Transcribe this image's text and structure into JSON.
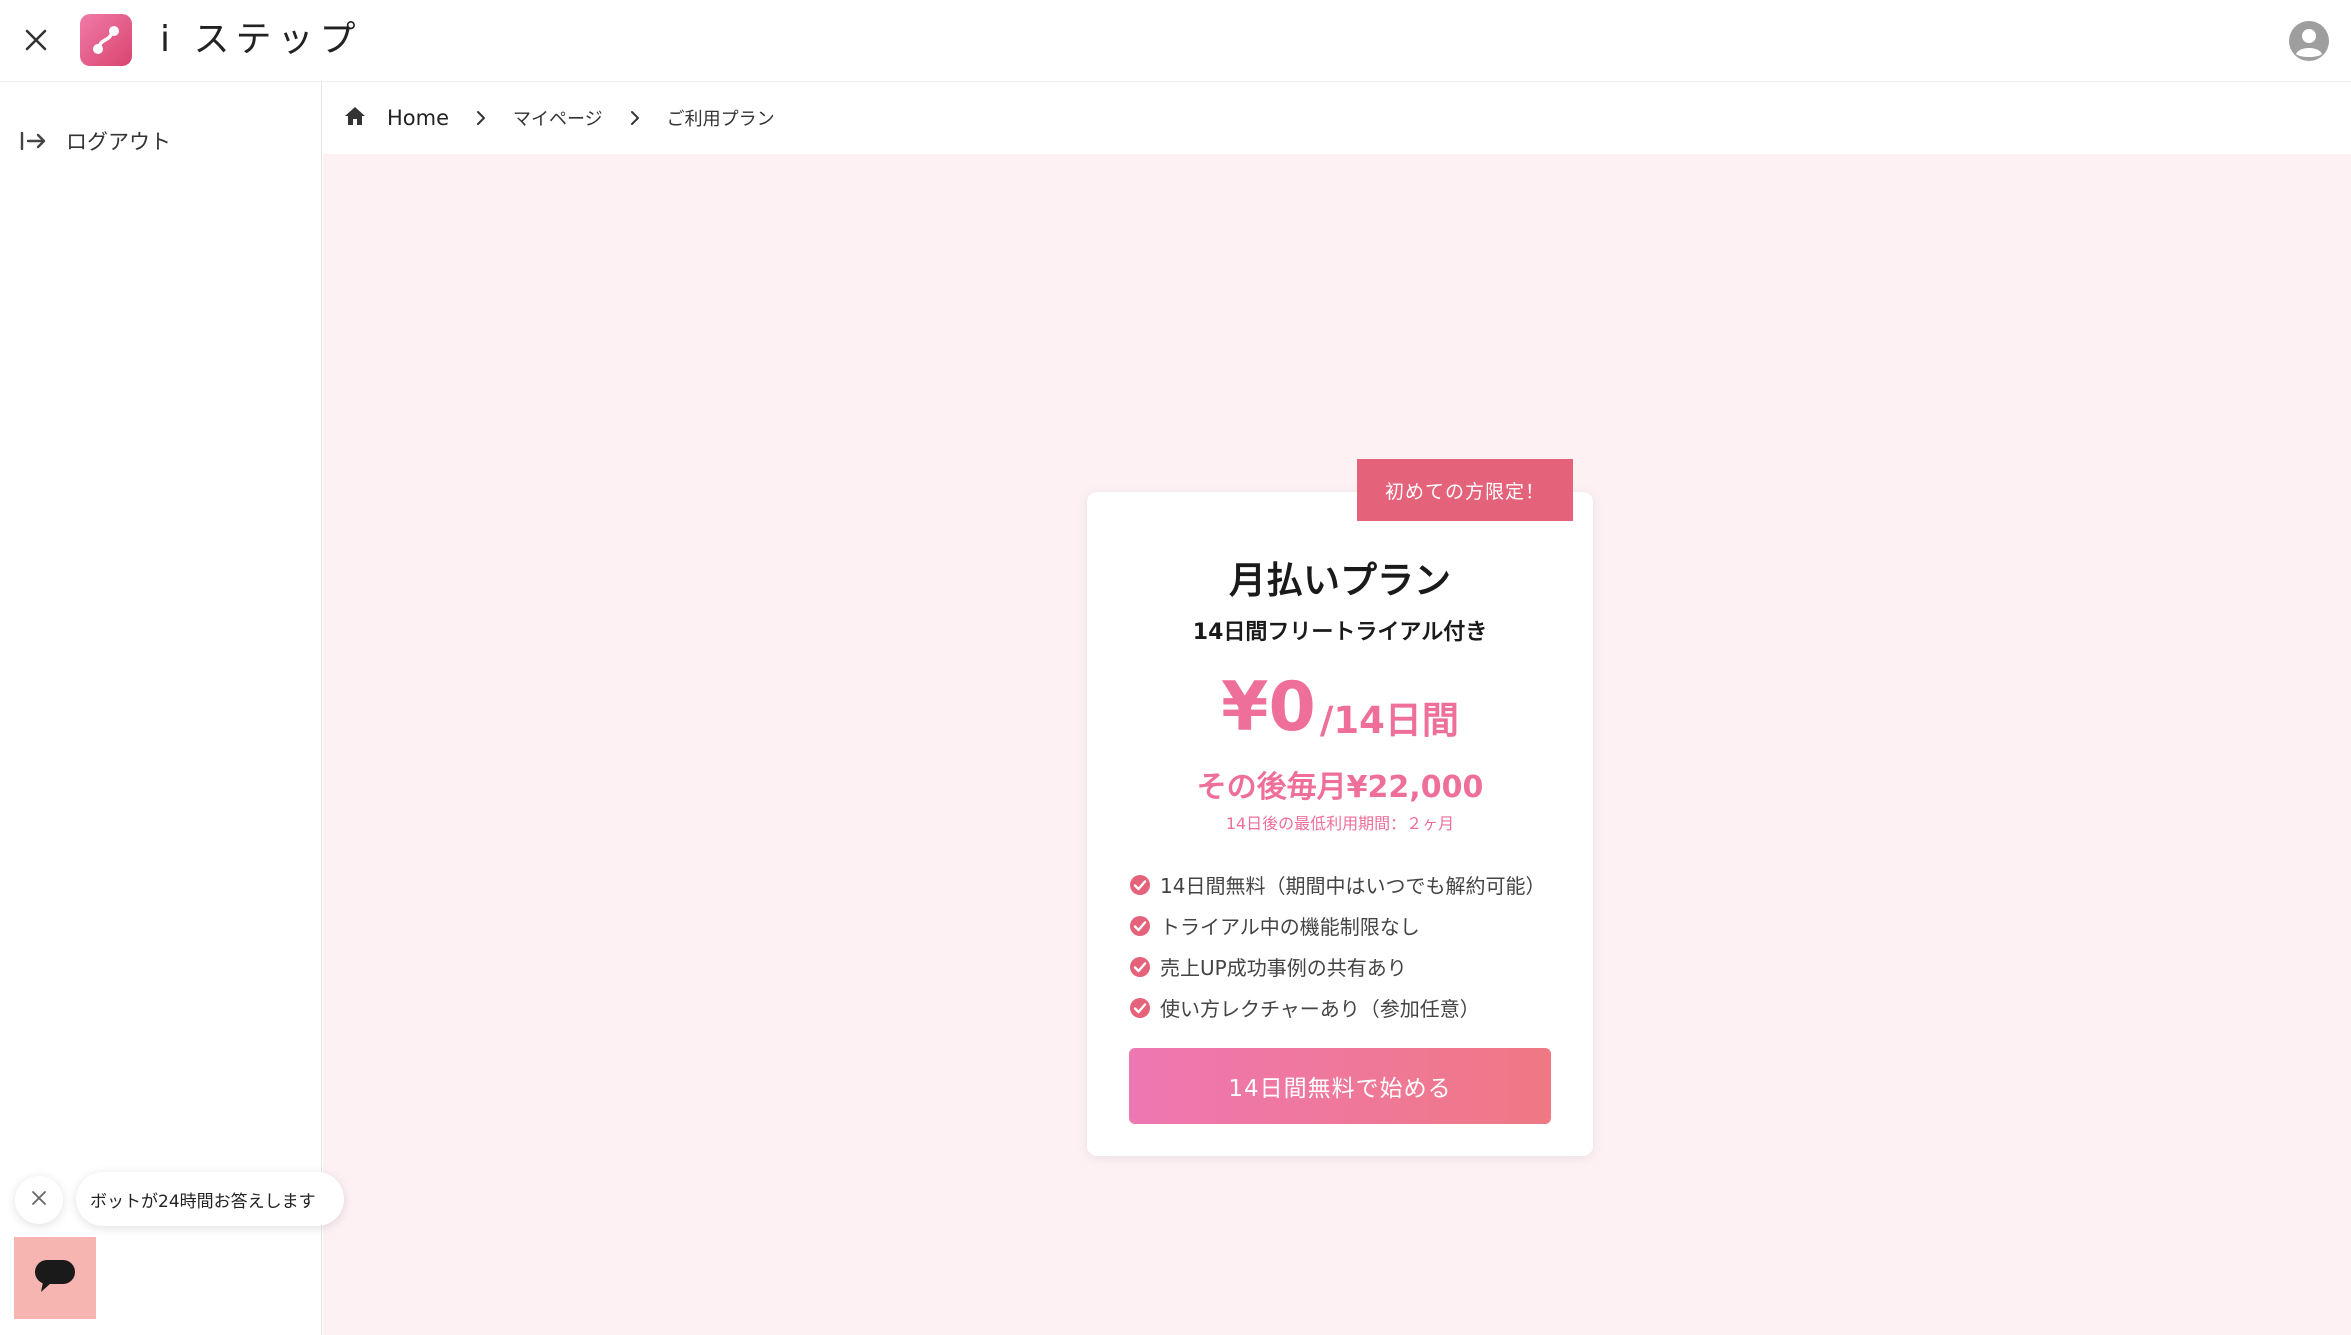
{
  "header": {
    "app_title": "i ステップ",
    "close_icon": "close-icon",
    "avatar_icon": "user-avatar-icon"
  },
  "sidebar": {
    "logout_label": "ログアウト",
    "logout_icon": "logout-arrow-icon"
  },
  "breadcrumb": {
    "items": [
      "Home",
      "マイページ",
      "ご利用プラン"
    ],
    "home_icon": "home-icon"
  },
  "plan": {
    "badge": "初めての方限定！",
    "title": "月払いプラン",
    "subtitle": "14日間フリートライアル付き",
    "price": "¥0",
    "price_period": "/14日間",
    "after_price": "その後毎月¥22,000",
    "min_period_note": "14日後の最低利用期間：２ヶ月",
    "features": [
      "14日間無料（期間中はいつでも解約可能）",
      "トライアル中の機能制限なし",
      "売上UP成功事例の共有あり",
      "使い方レクチャーあり（参加任意）"
    ],
    "cta_label": "14日間無料で始める"
  },
  "chat": {
    "bubble_text": "ボットが24時間お答えします"
  },
  "colors": {
    "accent_pink": "#ef6f9b",
    "badge_red": "#e5627b",
    "background_pink": "#fdf1f4",
    "chat_launcher": "#f6b5b0"
  }
}
